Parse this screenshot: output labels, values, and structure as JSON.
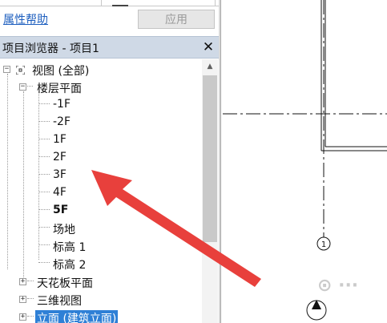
{
  "properties": {
    "help_link": "属性帮助",
    "apply_button": "应用"
  },
  "project_browser": {
    "title": "项目浏览器 - 项目1",
    "close_glyph": "✕",
    "tree": {
      "root": {
        "label": "视图 (全部)",
        "expander": "−"
      },
      "floor_plans": {
        "label": "楼层平面",
        "expander": "−",
        "items": [
          "-1F",
          "-2F",
          "1F",
          "2F",
          "3F",
          "4F",
          "5F",
          "场地",
          "标高 1",
          "标高 2"
        ],
        "active_item": "5F"
      },
      "ceiling_plans": {
        "label": "天花板平面",
        "expander": "+"
      },
      "3d_views": {
        "label": "三维视图",
        "expander": "+"
      },
      "elevations": {
        "label": "立面 (建筑立面)",
        "expander": "+"
      }
    },
    "scroll_up_glyph": "▲"
  },
  "drawing": {
    "grid_bubble_label": "1"
  },
  "colors": {
    "header_bg": "#cfd9e6",
    "selection": "#2f80d6",
    "link": "#1e5fbf",
    "arrow": "#e8403c"
  }
}
